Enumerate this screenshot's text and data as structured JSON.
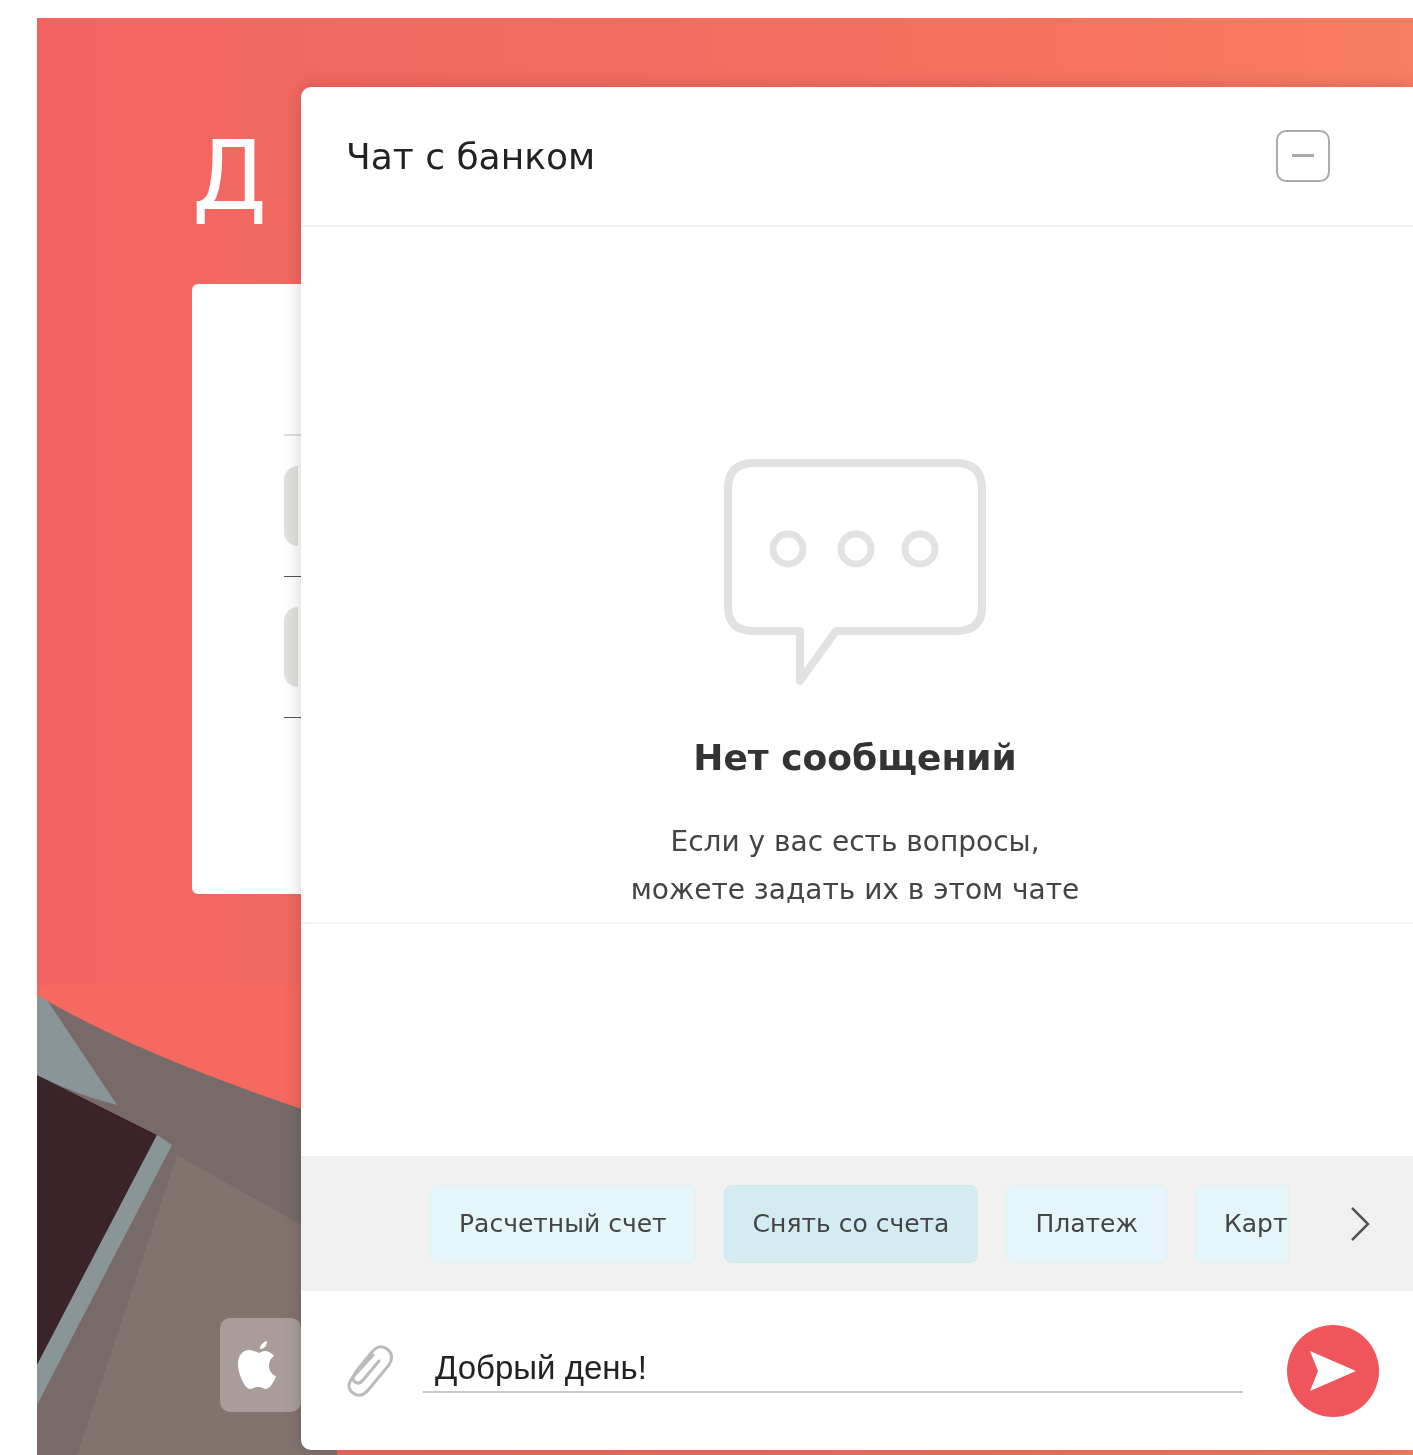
{
  "background": {
    "heading": "Д",
    "store_button": {
      "kind": "apple"
    }
  },
  "chat": {
    "title": "Чат с банком",
    "empty_state": {
      "title": "Нет сообщений",
      "lines": [
        "Если у вас есть вопросы,",
        "можете задать их в этом чате"
      ]
    },
    "quick_replies": [
      {
        "label": "Расчетный счет",
        "selected": false
      },
      {
        "label": "Снять со счета",
        "selected": true
      },
      {
        "label": "Платеж",
        "selected": false
      },
      {
        "label": "Карт",
        "selected": false
      }
    ],
    "message": {
      "value": "Добрый день!"
    }
  }
}
